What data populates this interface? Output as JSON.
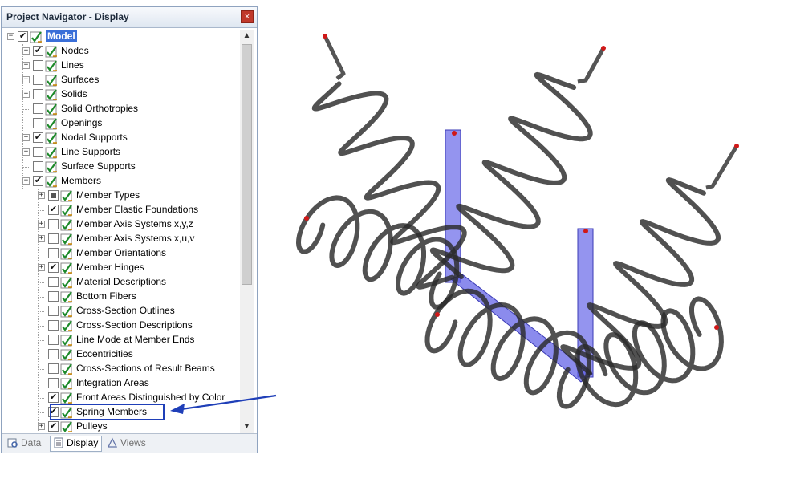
{
  "panel": {
    "title": "Project Navigator - Display",
    "close_glyph": "×",
    "tree": [
      {
        "label": "Model",
        "checked": true,
        "expander": "−",
        "selected": true
      },
      {
        "label": "Nodes",
        "checked": true,
        "expander": "+"
      },
      {
        "label": "Lines",
        "checked": false,
        "expander": "+"
      },
      {
        "label": "Surfaces",
        "checked": false,
        "expander": "+"
      },
      {
        "label": "Solids",
        "checked": false,
        "expander": "+"
      },
      {
        "label": "Solid Orthotropies",
        "checked": false,
        "expander": ""
      },
      {
        "label": "Openings",
        "checked": false,
        "expander": ""
      },
      {
        "label": "Nodal Supports",
        "checked": true,
        "expander": "+"
      },
      {
        "label": "Line Supports",
        "checked": false,
        "expander": "+"
      },
      {
        "label": "Surface Supports",
        "checked": false,
        "expander": ""
      },
      {
        "label": "Members",
        "checked": true,
        "expander": "−"
      },
      {
        "label": "Member Types",
        "checked": "partial",
        "expander": "+"
      },
      {
        "label": "Member Elastic Foundations",
        "checked": true,
        "expander": ""
      },
      {
        "label": "Member Axis Systems x,y,z",
        "checked": false,
        "expander": "+"
      },
      {
        "label": "Member Axis Systems x,u,v",
        "checked": false,
        "expander": "+"
      },
      {
        "label": "Member Orientations",
        "checked": false,
        "expander": ""
      },
      {
        "label": "Member Hinges",
        "checked": true,
        "expander": "+"
      },
      {
        "label": "Material Descriptions",
        "checked": false,
        "expander": ""
      },
      {
        "label": "Bottom Fibers",
        "checked": false,
        "expander": ""
      },
      {
        "label": "Cross-Section Outlines",
        "checked": false,
        "expander": ""
      },
      {
        "label": "Cross-Section Descriptions",
        "checked": false,
        "expander": ""
      },
      {
        "label": "Line Mode at Member Ends",
        "checked": false,
        "expander": ""
      },
      {
        "label": "Eccentricities",
        "checked": false,
        "expander": ""
      },
      {
        "label": "Cross-Sections of Result Beams",
        "checked": false,
        "expander": ""
      },
      {
        "label": "Integration Areas",
        "checked": false,
        "expander": ""
      },
      {
        "label": "Front Areas Distinguished by Color",
        "checked": true,
        "expander": ""
      },
      {
        "label": "Spring Members",
        "checked": true,
        "expander": ""
      },
      {
        "label": "Pulleys",
        "checked": true,
        "expander": "+"
      }
    ],
    "tabs": [
      {
        "label": "Data",
        "icon": "data-icon",
        "active": false
      },
      {
        "label": "Display",
        "icon": "display-icon",
        "active": true
      },
      {
        "label": "Views",
        "icon": "views-icon",
        "active": false
      }
    ],
    "scroll_up": "▲",
    "scroll_down": "▼"
  },
  "colors": {
    "selection": "#3a6fd8",
    "highlight_box": "#1f3fb8",
    "spring": "#2b2b2b",
    "member": "#5a5ae6"
  }
}
